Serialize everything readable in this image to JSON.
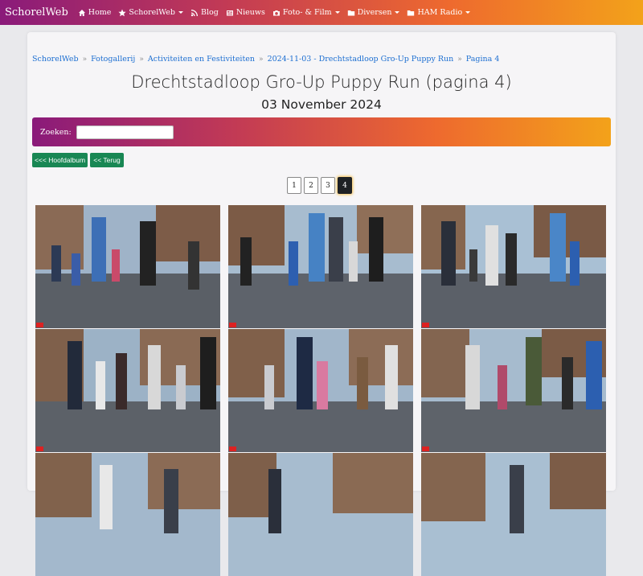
{
  "nav": {
    "brand": "SchorelWeb",
    "items": [
      {
        "label": "Home",
        "icon": "home-icon",
        "dropdown": false
      },
      {
        "label": "SchorelWeb",
        "icon": "star-icon",
        "dropdown": true
      },
      {
        "label": "Blog",
        "icon": "rss-icon",
        "dropdown": false
      },
      {
        "label": "Nieuws",
        "icon": "newspaper-icon",
        "dropdown": false
      },
      {
        "label": "Foto- & Film",
        "icon": "camera-icon",
        "dropdown": true
      },
      {
        "label": "Diversen",
        "icon": "folder-icon",
        "dropdown": true
      },
      {
        "label": "HAM Radio",
        "icon": "folder-icon",
        "dropdown": true
      }
    ]
  },
  "breadcrumb": [
    "SchorelWeb",
    "Fotogallerij",
    "Activiteiten en Festiviteiten",
    "2024-11-03 - Drechtstadloop Gro-Up Puppy Run",
    "Pagina 4"
  ],
  "breadcrumb_separator": "»",
  "page": {
    "title": "Drechtstadloop Gro-Up Puppy Run (pagina 4)",
    "date": "03 November 2024"
  },
  "search": {
    "label": "Zoeken:",
    "value": "",
    "placeholder": ""
  },
  "buttons": {
    "main_album": "<<< Hoofdalbum",
    "back": "<< Terug"
  },
  "pagination": {
    "pages": [
      "1",
      "2",
      "3",
      "4"
    ],
    "active": "4"
  },
  "colors": {
    "gradient_start": "#8a1a7a",
    "gradient_end": "#f3a21a",
    "button_green": "#198754",
    "link_blue": "#1d6fd1"
  }
}
